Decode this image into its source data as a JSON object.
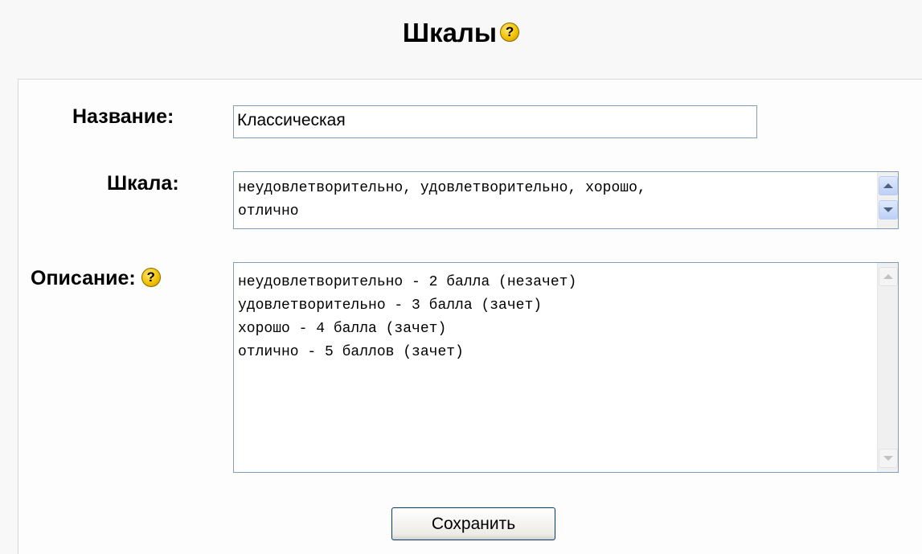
{
  "page": {
    "title": "Шкалы",
    "help_icon_glyph": "?"
  },
  "form": {
    "name_label": "Название:",
    "name_value": "Классическая",
    "scale_label": "Шкала:",
    "scale_value": "неудовлетворительно, удовлетворительно, хорошо,\nотлично",
    "description_label": "Описание:",
    "description_value": "неудовлетворительно - 2 балла (незачет)\nудовлетворительно - 3 балла (зачет)\nхорошо - 4 балла (зачет)\nотлично - 5 баллов (зачет)",
    "save_label": "Сохранить"
  },
  "icons": {
    "help": "help-icon",
    "scroll_up": "chevron-up-icon",
    "scroll_down": "chevron-down-icon"
  },
  "colors": {
    "help_icon": "#f2c200",
    "input_border": "#7f9db9",
    "button_border": "#003c74"
  }
}
